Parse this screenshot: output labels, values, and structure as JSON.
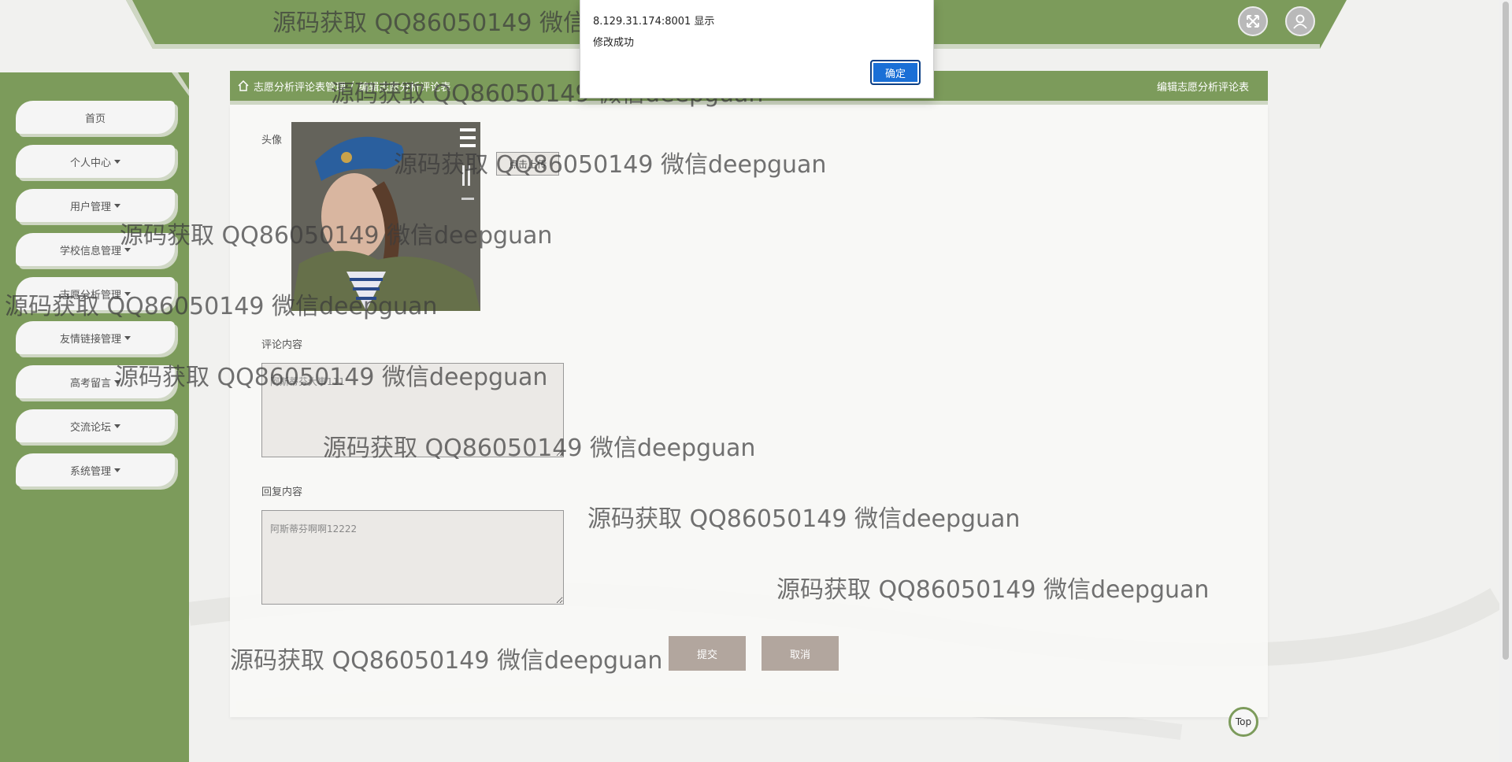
{
  "sidebar": {
    "items": [
      {
        "label": "首页"
      },
      {
        "label": "个人中心"
      },
      {
        "label": "用户管理"
      },
      {
        "label": "学校信息管理"
      },
      {
        "label": "志愿分析管理"
      },
      {
        "label": "友情链接管理"
      },
      {
        "label": "高考留言"
      },
      {
        "label": "交流论坛"
      },
      {
        "label": "系统管理"
      }
    ]
  },
  "breadcrumb": {
    "home": "志愿分析评论表管理",
    "current": "编辑志愿分析评论表",
    "right_title": "编辑志愿分析评论表"
  },
  "form": {
    "avatar_label": "头像",
    "upload_label": "点击上传",
    "comment_label": "评论内容",
    "comment_value": "阿斯蒂芬大事111",
    "reply_label": "回复内容",
    "reply_value": "阿斯蒂芬啊啊12222",
    "submit_label": "提交",
    "cancel_label": "取消"
  },
  "dialog": {
    "title": "8.129.31.174:8001 显示",
    "message": "修改成功",
    "ok_label": "确定"
  },
  "top_button": {
    "label": "Top"
  },
  "watermark": "源码获取 QQ86050149 微信deepguan",
  "colors": {
    "accent": "#7c9b5b",
    "button": "#b2a69e",
    "dialog_ok": "#1a6fd6"
  }
}
